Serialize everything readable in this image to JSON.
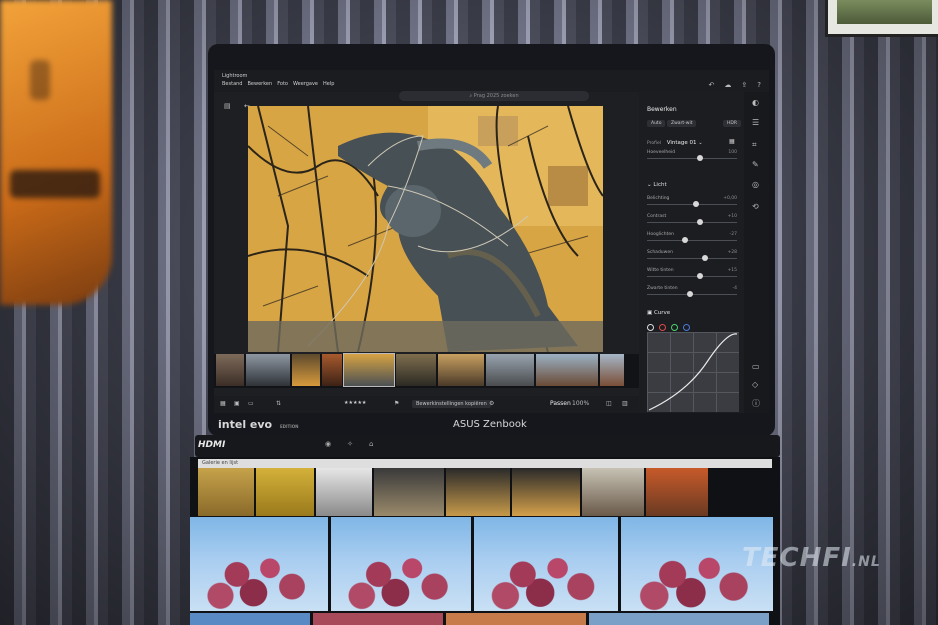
{
  "lightroom": {
    "app_title": "Lightroom",
    "menu": [
      "Bestand",
      "Bewerken",
      "Foto",
      "Weergave",
      "Help"
    ],
    "search_placeholder": "Prag 2025 zoeken",
    "panel": {
      "title": "Bewerken",
      "buttons": [
        "Auto",
        "Zwart-wit",
        "HDR"
      ],
      "profile_label": "Profiel",
      "profile_value": "Vintage 01",
      "amount_label": "Hoeveelheid",
      "amount_value": "100",
      "light_section": "Licht",
      "light_sliders": [
        {
          "label": "Belichting",
          "value": "+0,00",
          "pos": 0.55
        },
        {
          "label": "Contrast",
          "value": "+10",
          "pos": 0.6
        },
        {
          "label": "Hooglichten",
          "value": "-27",
          "pos": 0.42
        },
        {
          "label": "Schaduwen",
          "value": "+28",
          "pos": 0.66
        },
        {
          "label": "Witte tinten",
          "value": "+15",
          "pos": 0.59
        },
        {
          "label": "Zwarte tinten",
          "value": "-4",
          "pos": 0.48
        }
      ],
      "curve_label": "Curve"
    },
    "bottom": {
      "copy_settings": "Bewerkinstellingen kopiëren",
      "fit_label": "Passen",
      "zoom": "100%",
      "rating": "★★★★★"
    }
  },
  "bezel": {
    "brand_left": "intel evo",
    "brand_left_sub": "EDITION",
    "brand_center": "ASUS Zenbook"
  },
  "hinge": {
    "hdmi": "HDMI"
  },
  "second_screen": {
    "header": "Galerie en lijst"
  },
  "watermark": {
    "main": "TECHFI",
    "suffix": ".NL"
  },
  "icons": [
    "search-icon",
    "undo-icon",
    "cloud-icon",
    "share-icon",
    "help-icon",
    "edit-icon",
    "crop-icon",
    "heal-icon",
    "mask-icon",
    "history-icon",
    "info-icon",
    "chat-icon",
    "tag-icon",
    "dropdown-icon"
  ]
}
